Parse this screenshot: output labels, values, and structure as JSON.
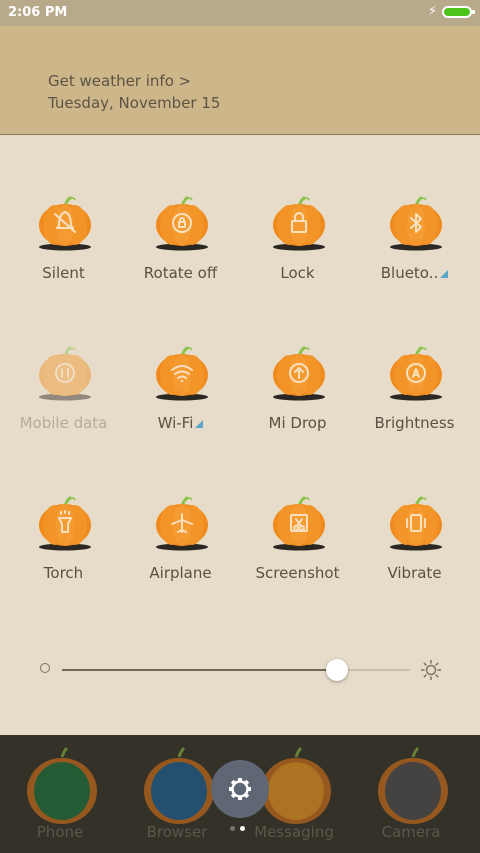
{
  "status_bar": {
    "time": "2:06 PM",
    "battery_color": "#4cc21a"
  },
  "weather": {
    "link_text": "Get weather info >",
    "date": "Tuesday, November 15"
  },
  "toggles": [
    {
      "label": "Silent",
      "icon": "silent-bell-icon",
      "has_settings_marker": false
    },
    {
      "label": "Rotate off",
      "icon": "rotate-lock-icon",
      "has_settings_marker": false
    },
    {
      "label": "Lock",
      "icon": "lock-icon",
      "has_settings_marker": false
    },
    {
      "label": "Blueto..",
      "icon": "bluetooth-icon",
      "has_settings_marker": true
    },
    {
      "label": "Mobile data",
      "icon": "mobile-data-icon",
      "has_settings_marker": false,
      "disabled": true
    },
    {
      "label": "Wi-Fi",
      "icon": "wifi-icon",
      "has_settings_marker": true
    },
    {
      "label": "Mi Drop",
      "icon": "mi-drop-icon",
      "has_settings_marker": false
    },
    {
      "label": "Brightness",
      "icon": "brightness-auto-icon",
      "has_settings_marker": false
    },
    {
      "label": "Torch",
      "icon": "torch-icon",
      "has_settings_marker": false
    },
    {
      "label": "Airplane",
      "icon": "airplane-icon",
      "has_settings_marker": false
    },
    {
      "label": "Screenshot",
      "icon": "screenshot-scissors-icon",
      "has_settings_marker": false
    },
    {
      "label": "Vibrate",
      "icon": "vibrate-icon",
      "has_settings_marker": false
    }
  ],
  "brightness_slider": {
    "level": 0.79
  },
  "dock": [
    {
      "label": "Phone",
      "icon": "phone-icon",
      "color": "#1f6a3a"
    },
    {
      "label": "Browser",
      "icon": "browser-icon",
      "color": "#1f5a86"
    },
    {
      "label": "Messaging",
      "icon": "messaging-icon",
      "color": "#d68a21"
    },
    {
      "label": "Camera",
      "icon": "camera-icon",
      "color": "#4a4a4a"
    }
  ],
  "page_indicator": {
    "count": 2,
    "active": 1
  },
  "colors": {
    "pumpkin": "#f08a1c",
    "stem": "#8bc34a",
    "settings_marker": "#5aa6c9"
  }
}
